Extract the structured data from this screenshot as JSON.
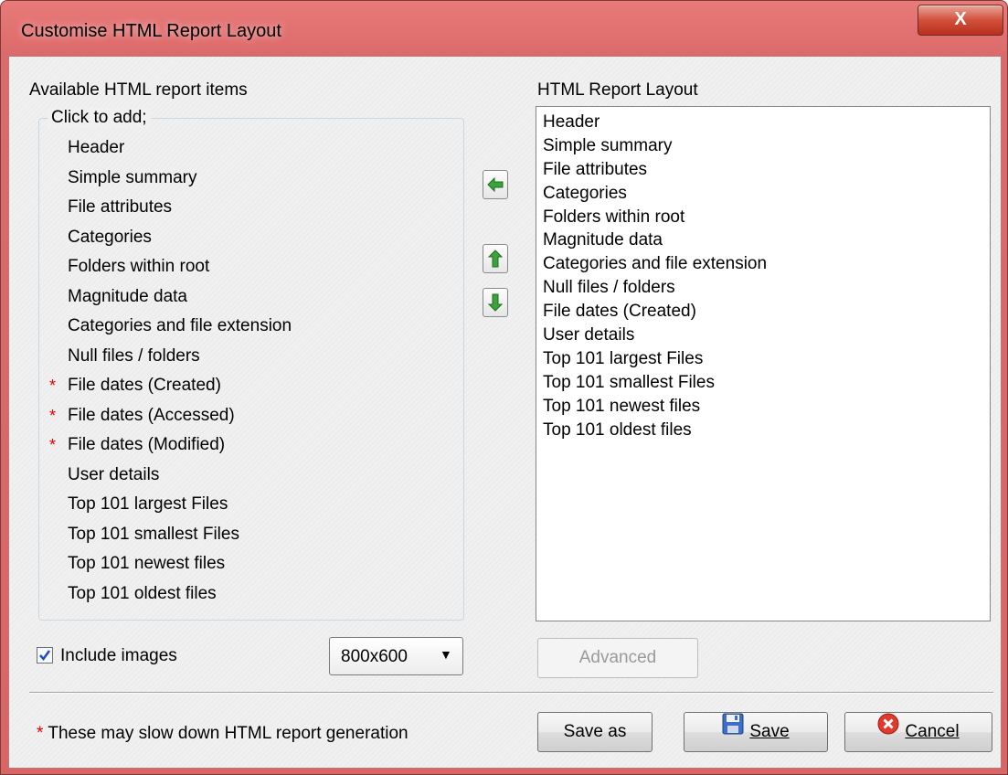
{
  "window": {
    "title": "Customise HTML Report Layout",
    "close_glyph": "X"
  },
  "left_panel": {
    "heading": "Available HTML report items",
    "group_caption": "Click to add;",
    "items": [
      {
        "label": "Header",
        "slow": false
      },
      {
        "label": "Simple summary",
        "slow": false
      },
      {
        "label": "File attributes",
        "slow": false
      },
      {
        "label": "Categories",
        "slow": false
      },
      {
        "label": "Folders within root",
        "slow": false
      },
      {
        "label": "Magnitude data",
        "slow": false
      },
      {
        "label": "Categories and file extension",
        "slow": false
      },
      {
        "label": "Null files / folders",
        "slow": false
      },
      {
        "label": "File dates (Created)",
        "slow": true
      },
      {
        "label": "File dates (Accessed)",
        "slow": true
      },
      {
        "label": "File dates (Modified)",
        "slow": true
      },
      {
        "label": "User details",
        "slow": false
      },
      {
        "label": "Top 101 largest Files",
        "slow": false
      },
      {
        "label": "Top 101 smallest Files",
        "slow": false
      },
      {
        "label": "Top 101 newest files",
        "slow": false
      },
      {
        "label": "Top 101 oldest files",
        "slow": false
      }
    ],
    "star": "*"
  },
  "right_panel": {
    "heading": "HTML Report Layout",
    "items": [
      "Header",
      "Simple summary",
      "File attributes",
      "Categories",
      "Folders within root",
      "Magnitude data",
      "Categories and file extension",
      "Null files / folders",
      "File dates (Created)",
      "User details",
      "Top 101 largest Files",
      "Top 101 smallest Files",
      "Top 101 newest files",
      "Top 101 oldest files"
    ]
  },
  "options": {
    "include_images_label": "Include images",
    "include_images_checked": true,
    "resolution_value": "800x600"
  },
  "buttons": {
    "advanced": "Advanced",
    "save_as": "Save as",
    "save": "Save",
    "cancel": "Cancel"
  },
  "footer": {
    "star": "*",
    "note": "These may slow down HTML report generation"
  },
  "icons": {
    "move_left": "arrow-left-icon",
    "move_up": "arrow-up-icon",
    "move_down": "arrow-down-icon",
    "save": "floppy-disk-icon",
    "cancel": "cancel-icon"
  },
  "colors": {
    "title_bar": "#dc6a6a",
    "arrow_green": "#3aa33a",
    "warning_star": "#e00000"
  }
}
